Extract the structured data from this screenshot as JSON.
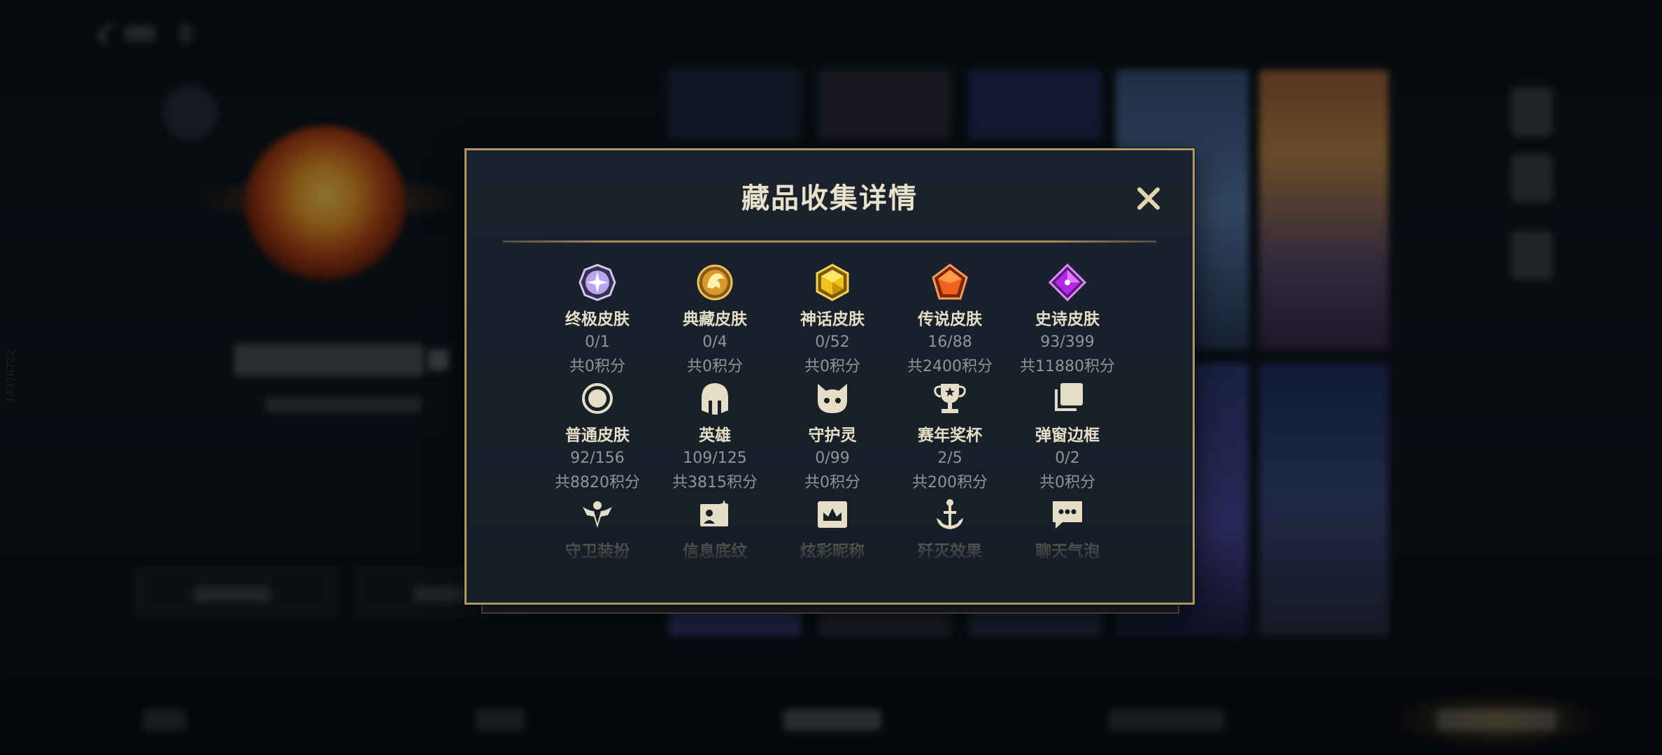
{
  "modal": {
    "title": "藏品收集详情",
    "close_icon": "close-icon",
    "items": [
      {
        "icon": "ultimate-skin-icon",
        "name": "终极皮肤",
        "count": "0/1",
        "points": "共0积分"
      },
      {
        "icon": "collector-skin-icon",
        "name": "典藏皮肤",
        "count": "0/4",
        "points": "共0积分"
      },
      {
        "icon": "mythic-skin-icon",
        "name": "神话皮肤",
        "count": "0/52",
        "points": "共0积分"
      },
      {
        "icon": "legendary-skin-icon",
        "name": "传说皮肤",
        "count": "16/88",
        "points": "共2400积分"
      },
      {
        "icon": "epic-skin-icon",
        "name": "史诗皮肤",
        "count": "93/399",
        "points": "共11880积分"
      },
      {
        "icon": "normal-skin-icon",
        "name": "普通皮肤",
        "count": "92/156",
        "points": "共8820积分"
      },
      {
        "icon": "hero-helmet-icon",
        "name": "英雄",
        "count": "109/125",
        "points": "共3815积分"
      },
      {
        "icon": "guardian-spirit-icon",
        "name": "守护灵",
        "count": "0/99",
        "points": "共0积分"
      },
      {
        "icon": "season-trophy-icon",
        "name": "赛年奖杯",
        "count": "2/5",
        "points": "共200积分"
      },
      {
        "icon": "popup-frame-icon",
        "name": "弹窗边框",
        "count": "0/2",
        "points": "共0积分"
      },
      {
        "icon": "guardian-outfit-icon",
        "name": "守卫装扮"
      },
      {
        "icon": "info-card-icon",
        "name": "信息底纹"
      },
      {
        "icon": "colorful-nickname-icon",
        "name": "炫彩昵称"
      },
      {
        "icon": "elimination-effect-icon",
        "name": "歼灭效果"
      },
      {
        "icon": "chat-bubble-icon",
        "name": "聊天气泡"
      }
    ]
  },
  "background": {
    "side_id": "14376722"
  },
  "colors": {
    "border_gold": "#b09866",
    "title": "#e9e1cc",
    "label": "#e6ddc6",
    "muted": "#8d959d"
  }
}
